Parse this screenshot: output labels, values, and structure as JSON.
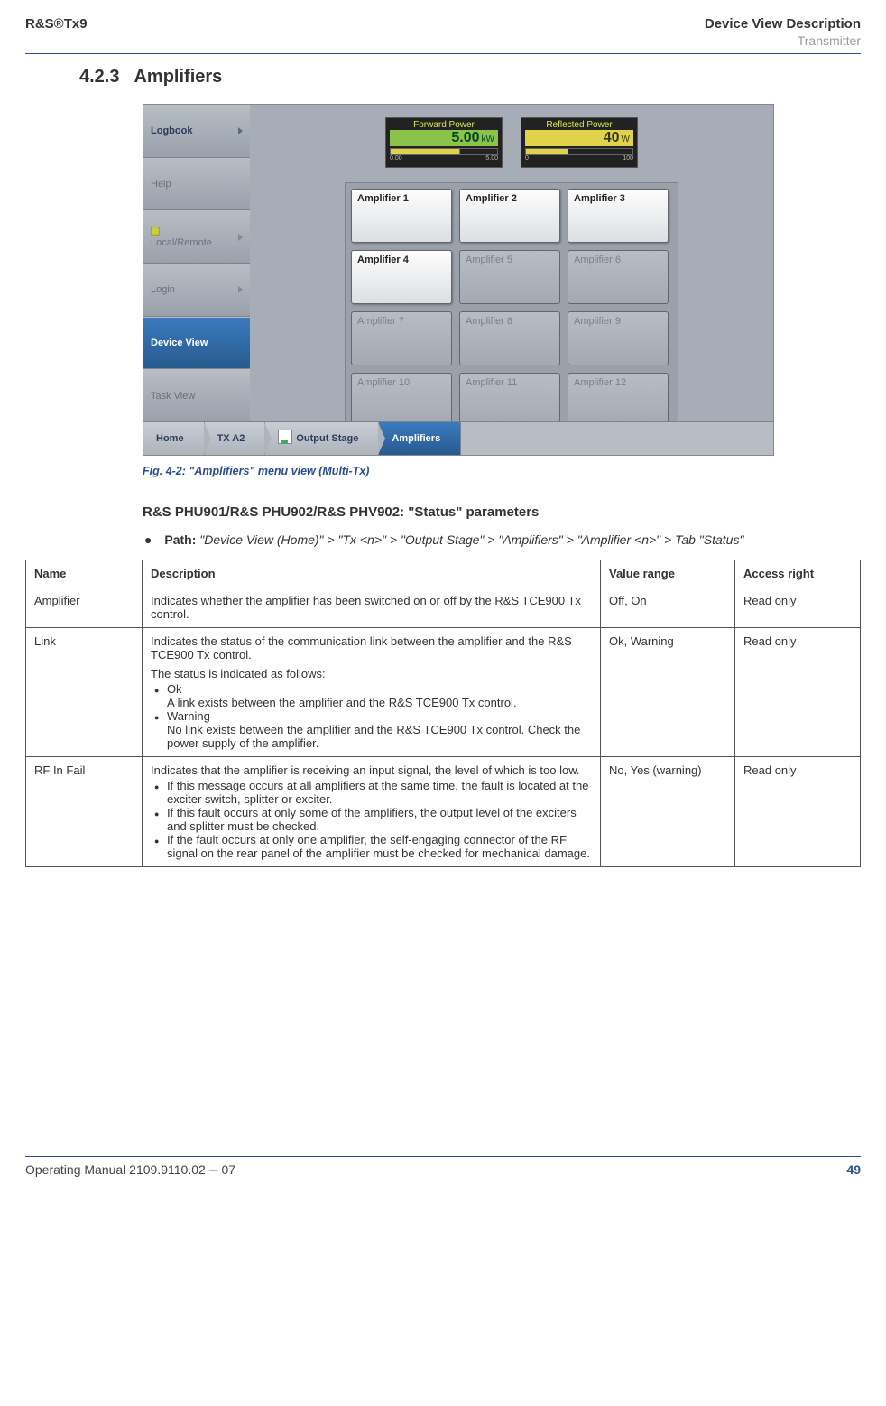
{
  "header": {
    "left": "R&S®Tx9",
    "right": "Device View Description",
    "sub": "Transmitter"
  },
  "section": {
    "num": "4.2.3",
    "title": "Amplifiers"
  },
  "figure": {
    "sidebar": {
      "logbook": "Logbook",
      "help": "Help",
      "local_remote": "Local/Remote",
      "login": "Login",
      "device_view": "Device View",
      "task_view": "Task View"
    },
    "meters": {
      "fwd": {
        "title": "Forward Power",
        "value": "5.00",
        "unit": "kW",
        "min": "0.00",
        "max": "5.00"
      },
      "ref": {
        "title": "Reflected Power",
        "value": "40",
        "unit": "W",
        "min": "0",
        "max": "100"
      }
    },
    "amps": {
      "a1": "Amplifier 1",
      "a2": "Amplifier 2",
      "a3": "Amplifier 3",
      "a4": "Amplifier 4",
      "a5": "Amplifier 5",
      "a6": "Amplifier 6",
      "a7": "Amplifier 7",
      "a8": "Amplifier 8",
      "a9": "Amplifier 9",
      "a10": "Amplifier 10",
      "a11": "Amplifier 11",
      "a12": "Amplifier 12"
    },
    "crumbs": {
      "home": "Home",
      "txa2": "TX A2",
      "ostage": "Output Stage",
      "amps": "Amplifiers"
    },
    "caption": "Fig. 4-2: \"Amplifiers\" menu view (Multi‑Tx)"
  },
  "subhead": "R&S PHU901/R&S PHU902/R&S PHV902: \"Status\" parameters",
  "path": {
    "label": "Path:",
    "value": "\"Device View (Home)\" > \"Tx <n>\" > \"Output Stage\" > \"Amplifiers\" > \"Amplifier <n>\" > Tab \"Status\""
  },
  "table": {
    "head": {
      "c1": "Name",
      "c2": "Description",
      "c3": "Value range",
      "c4": "Access right"
    },
    "r1": {
      "name": "Amplifier",
      "desc": "Indicates whether the amplifier has been switched on or off by the R&S TCE900 Tx control.",
      "range": "Off, On",
      "access": "Read only"
    },
    "r2": {
      "name": "Link",
      "desc_intro": "Indicates the status of the communication link between the amplifier and the R&S TCE900 Tx control.",
      "desc_sub": "The status is indicated as follows:",
      "ok_t": "Ok",
      "ok_d": "A link exists between the amplifier and the R&S TCE900 Tx control.",
      "warn_t": "Warning",
      "warn_d": "No link exists between the amplifier and the R&S TCE900 Tx control. Check the power supply of the amplifier.",
      "range": "Ok, Warning",
      "access": "Read only"
    },
    "r3": {
      "name": "RF In Fail",
      "desc_intro": "Indicates that the amplifier is receiving an input signal, the level of which is too low.",
      "b1": "If this message occurs at all amplifiers at the same time, the fault is located at the exciter switch, splitter or exciter.",
      "b2": "If this fault occurs at only some of the amplifiers, the output level of the exciters and splitter must be checked.",
      "b3": "If the fault occurs at only one amplifier, the self‑engaging connector of the RF signal on the rear panel of the amplifier must be checked for mechanical damage.",
      "range": "No, Yes (warning)",
      "access": "Read only"
    }
  },
  "footer": {
    "left": "Operating Manual 2109.9110.02 ─ 07",
    "page": "49"
  }
}
